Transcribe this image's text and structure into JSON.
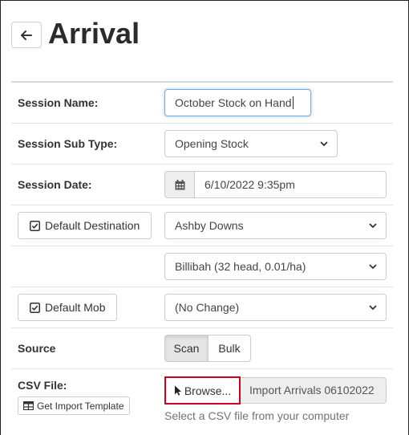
{
  "page": {
    "title": "Arrival"
  },
  "form": {
    "session_name": {
      "label": "Session Name:",
      "value": "October Stock on Hand"
    },
    "session_sub_type": {
      "label": "Session Sub Type:",
      "value": "Opening Stock"
    },
    "session_date": {
      "label": "Session Date:",
      "value": "6/10/2022 9:35pm"
    },
    "default_destination": {
      "button_label": "Default Destination",
      "property_value": "Ashby Downs",
      "paddock_value": "Billibah (32 head, 0.01/ha)"
    },
    "default_mob": {
      "button_label": "Default Mob",
      "value": "(No Change)"
    },
    "source": {
      "label": "Source",
      "options": [
        "Scan",
        "Bulk"
      ],
      "selected": "Scan"
    },
    "csv_file": {
      "label": "CSV File:",
      "template_button": "Get Import Template",
      "browse_label": "Browse...",
      "file_name": "Import Arrivals 06102022",
      "help_text": "Select a CSV file from your computer"
    }
  },
  "icons": {
    "back": "arrow-left-icon",
    "calendar": "calendar-icon",
    "check": "check-square-icon",
    "table": "table-icon",
    "pointer": "mouse-pointer-icon",
    "chevron": "chevron-down-icon"
  },
  "colors": {
    "highlight_border": "#d0021b",
    "focus_border": "#66afe9"
  }
}
